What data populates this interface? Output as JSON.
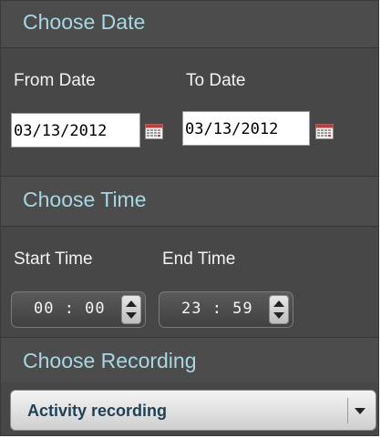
{
  "date_section": {
    "title": "Choose Date",
    "from_label": "From Date",
    "to_label": "To Date",
    "from_value": "03/13/2012",
    "to_value": "03/13/2012"
  },
  "time_section": {
    "title": "Choose Time",
    "start_label": "Start Time",
    "end_label": "End Time",
    "start_value": "00 : 00",
    "end_value": "23 : 59"
  },
  "recording_section": {
    "title": "Choose Recording",
    "selected": "Activity recording"
  },
  "icons": {
    "calendar": "calendar-icon",
    "spinner_up": "chevron-up-icon",
    "spinner_down": "chevron-down-icon",
    "dropdown": "dropdown-arrow-icon"
  },
  "colors": {
    "panel_bg": "#474747",
    "header_text": "#a8d7e4",
    "label_text": "#f2f2f2",
    "select_text": "#1f3f55"
  }
}
